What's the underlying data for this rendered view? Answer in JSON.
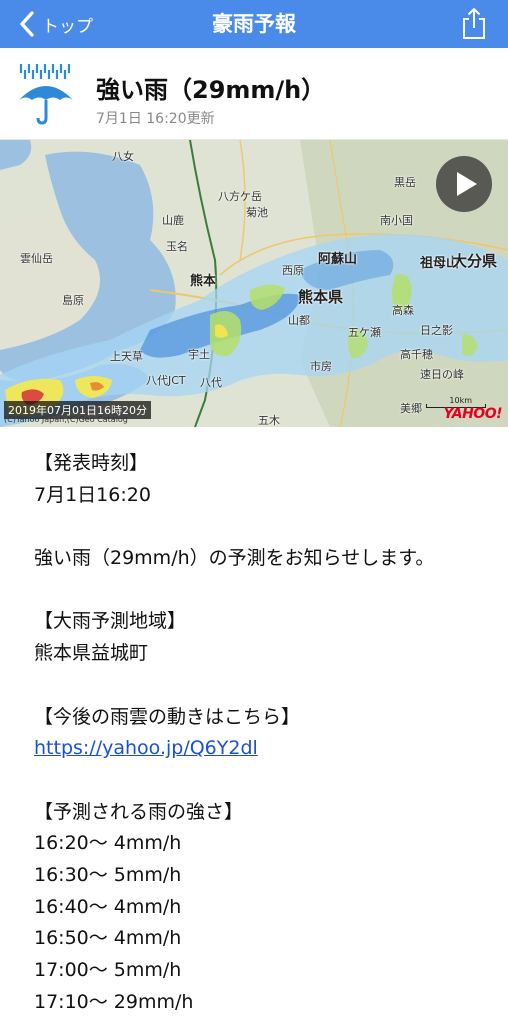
{
  "nav": {
    "back_label": "トップ",
    "title": "豪雨予報"
  },
  "alert": {
    "title": "強い雨（29mm/h）",
    "updated": "7月1日 16:20更新"
  },
  "map": {
    "timestamp": "2019年07月01日16時20分",
    "credit": "(C)Yahoo Japan,(C)Geo Catalog",
    "logo": "YAHOO!",
    "scale": "10km",
    "labels": {
      "kumamoto_pref": "熊本県",
      "oita_pref": "大分県",
      "kumamoto": "熊本",
      "shimabara": "島原",
      "aso": "阿蘇山",
      "sobosan": "祖母山",
      "kurodake": "黒岳",
      "yame": "八女",
      "kikuchi": "菊池",
      "yamaga": "山鹿",
      "tamana": "玉名",
      "unzen": "雲仙岳",
      "hakodate": "八方ケ岳",
      "nishihara": "西原",
      "yamato": "山都",
      "gokase": "五ケ瀬",
      "miyako": "日之影",
      "takachiho": "高千穂",
      "minami_oguni": "南小国",
      "yatsushiro": "八代",
      "yatsushiro_jct": "八代JCT",
      "kamiamakusa": "上天草",
      "uto": "宇土",
      "misato": "美郷",
      "itsuki": "五木",
      "ichifusa": "市房",
      "takamori": "高森",
      "sueyoshi": "速日の峰"
    }
  },
  "body": {
    "announce_header": "【発表時刻】",
    "announce_time": "7月1日16:20",
    "announce_message": "強い雨（29mm/h）の予測をお知らせします。",
    "region_header": "【大雨予測地域】",
    "region": "熊本県益城町",
    "link_header": "【今後の雨雲の動きはこちら】",
    "link": "https://yahoo.jp/Q6Y2dl",
    "forecast_header": "【予測される雨の強さ】",
    "forecast": [
      "16:20〜 4mm/h",
      "16:30〜 5mm/h",
      "16:40〜 4mm/h",
      "16:50〜 4mm/h",
      "17:00〜 5mm/h",
      "17:10〜 29mm/h"
    ]
  },
  "colors": {
    "navbar": "#4a8ae8",
    "link": "#1a4fd8",
    "rain_light": "#a6d6f5",
    "rain_mid": "#2f7bd9",
    "rain_heavy": "#f6e84a",
    "rain_strong": "#d63b3b"
  },
  "icons": [
    "chevron-left-icon",
    "share-icon",
    "umbrella-rain-icon",
    "play-icon"
  ]
}
